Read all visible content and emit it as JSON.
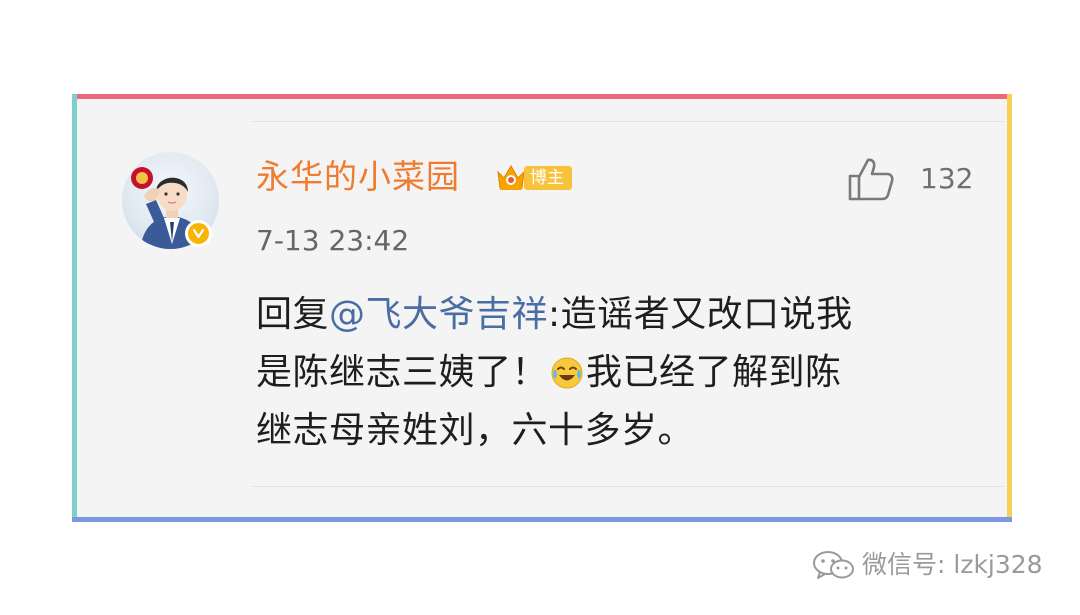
{
  "post": {
    "username": "永华的小菜园",
    "badge_label": "博主",
    "timestamp": "7-13 23:42",
    "like_count": "132",
    "reply_prefix": "回复",
    "mention": "@飞大爷吉祥",
    "text_line1_rest": ":造谣者又改口说我",
    "text_line2_before_emoji": "是陈继志三姨了！",
    "text_line2_after_emoji": "我已经了解到陈",
    "text_line3": "继志母亲姓刘，六十多岁。"
  },
  "watermark": {
    "text": "微信号: lzkj328"
  },
  "colors": {
    "username": "#ef7b2f",
    "mention": "#4a6ea3",
    "badge": "#f7c33c",
    "verified": "#f7b500",
    "frame_top": "#f0667a",
    "frame_left": "#7ccfcd",
    "frame_right": "#f7cf52",
    "frame_bottom": "#7b98e0"
  },
  "icons": {
    "like": "thumbs-up-icon",
    "verified": "verified-v-icon",
    "badge": "crown-icon",
    "emoji": "laugh-cry-emoji",
    "watermark": "wechat-icon"
  }
}
